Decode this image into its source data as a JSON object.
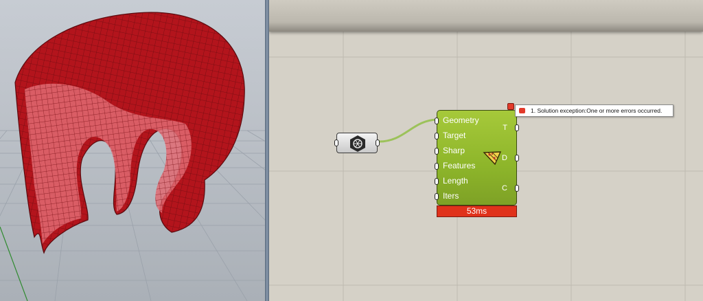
{
  "component": {
    "inputs": [
      "Geometry",
      "Target",
      "Sharp",
      "Features",
      "Length",
      "Iters"
    ],
    "outputs": [
      "T",
      "D",
      "C"
    ],
    "timing": "53ms"
  },
  "error": {
    "message": "1. Solution exception:One or more errors occurred."
  },
  "icons": {
    "param": "geometry-param-icon",
    "component": "remesh-triangle-icon"
  },
  "colors": {
    "component_green": "#8db52a",
    "error_red": "#e0321b",
    "mesh_red": "#b3141c"
  }
}
